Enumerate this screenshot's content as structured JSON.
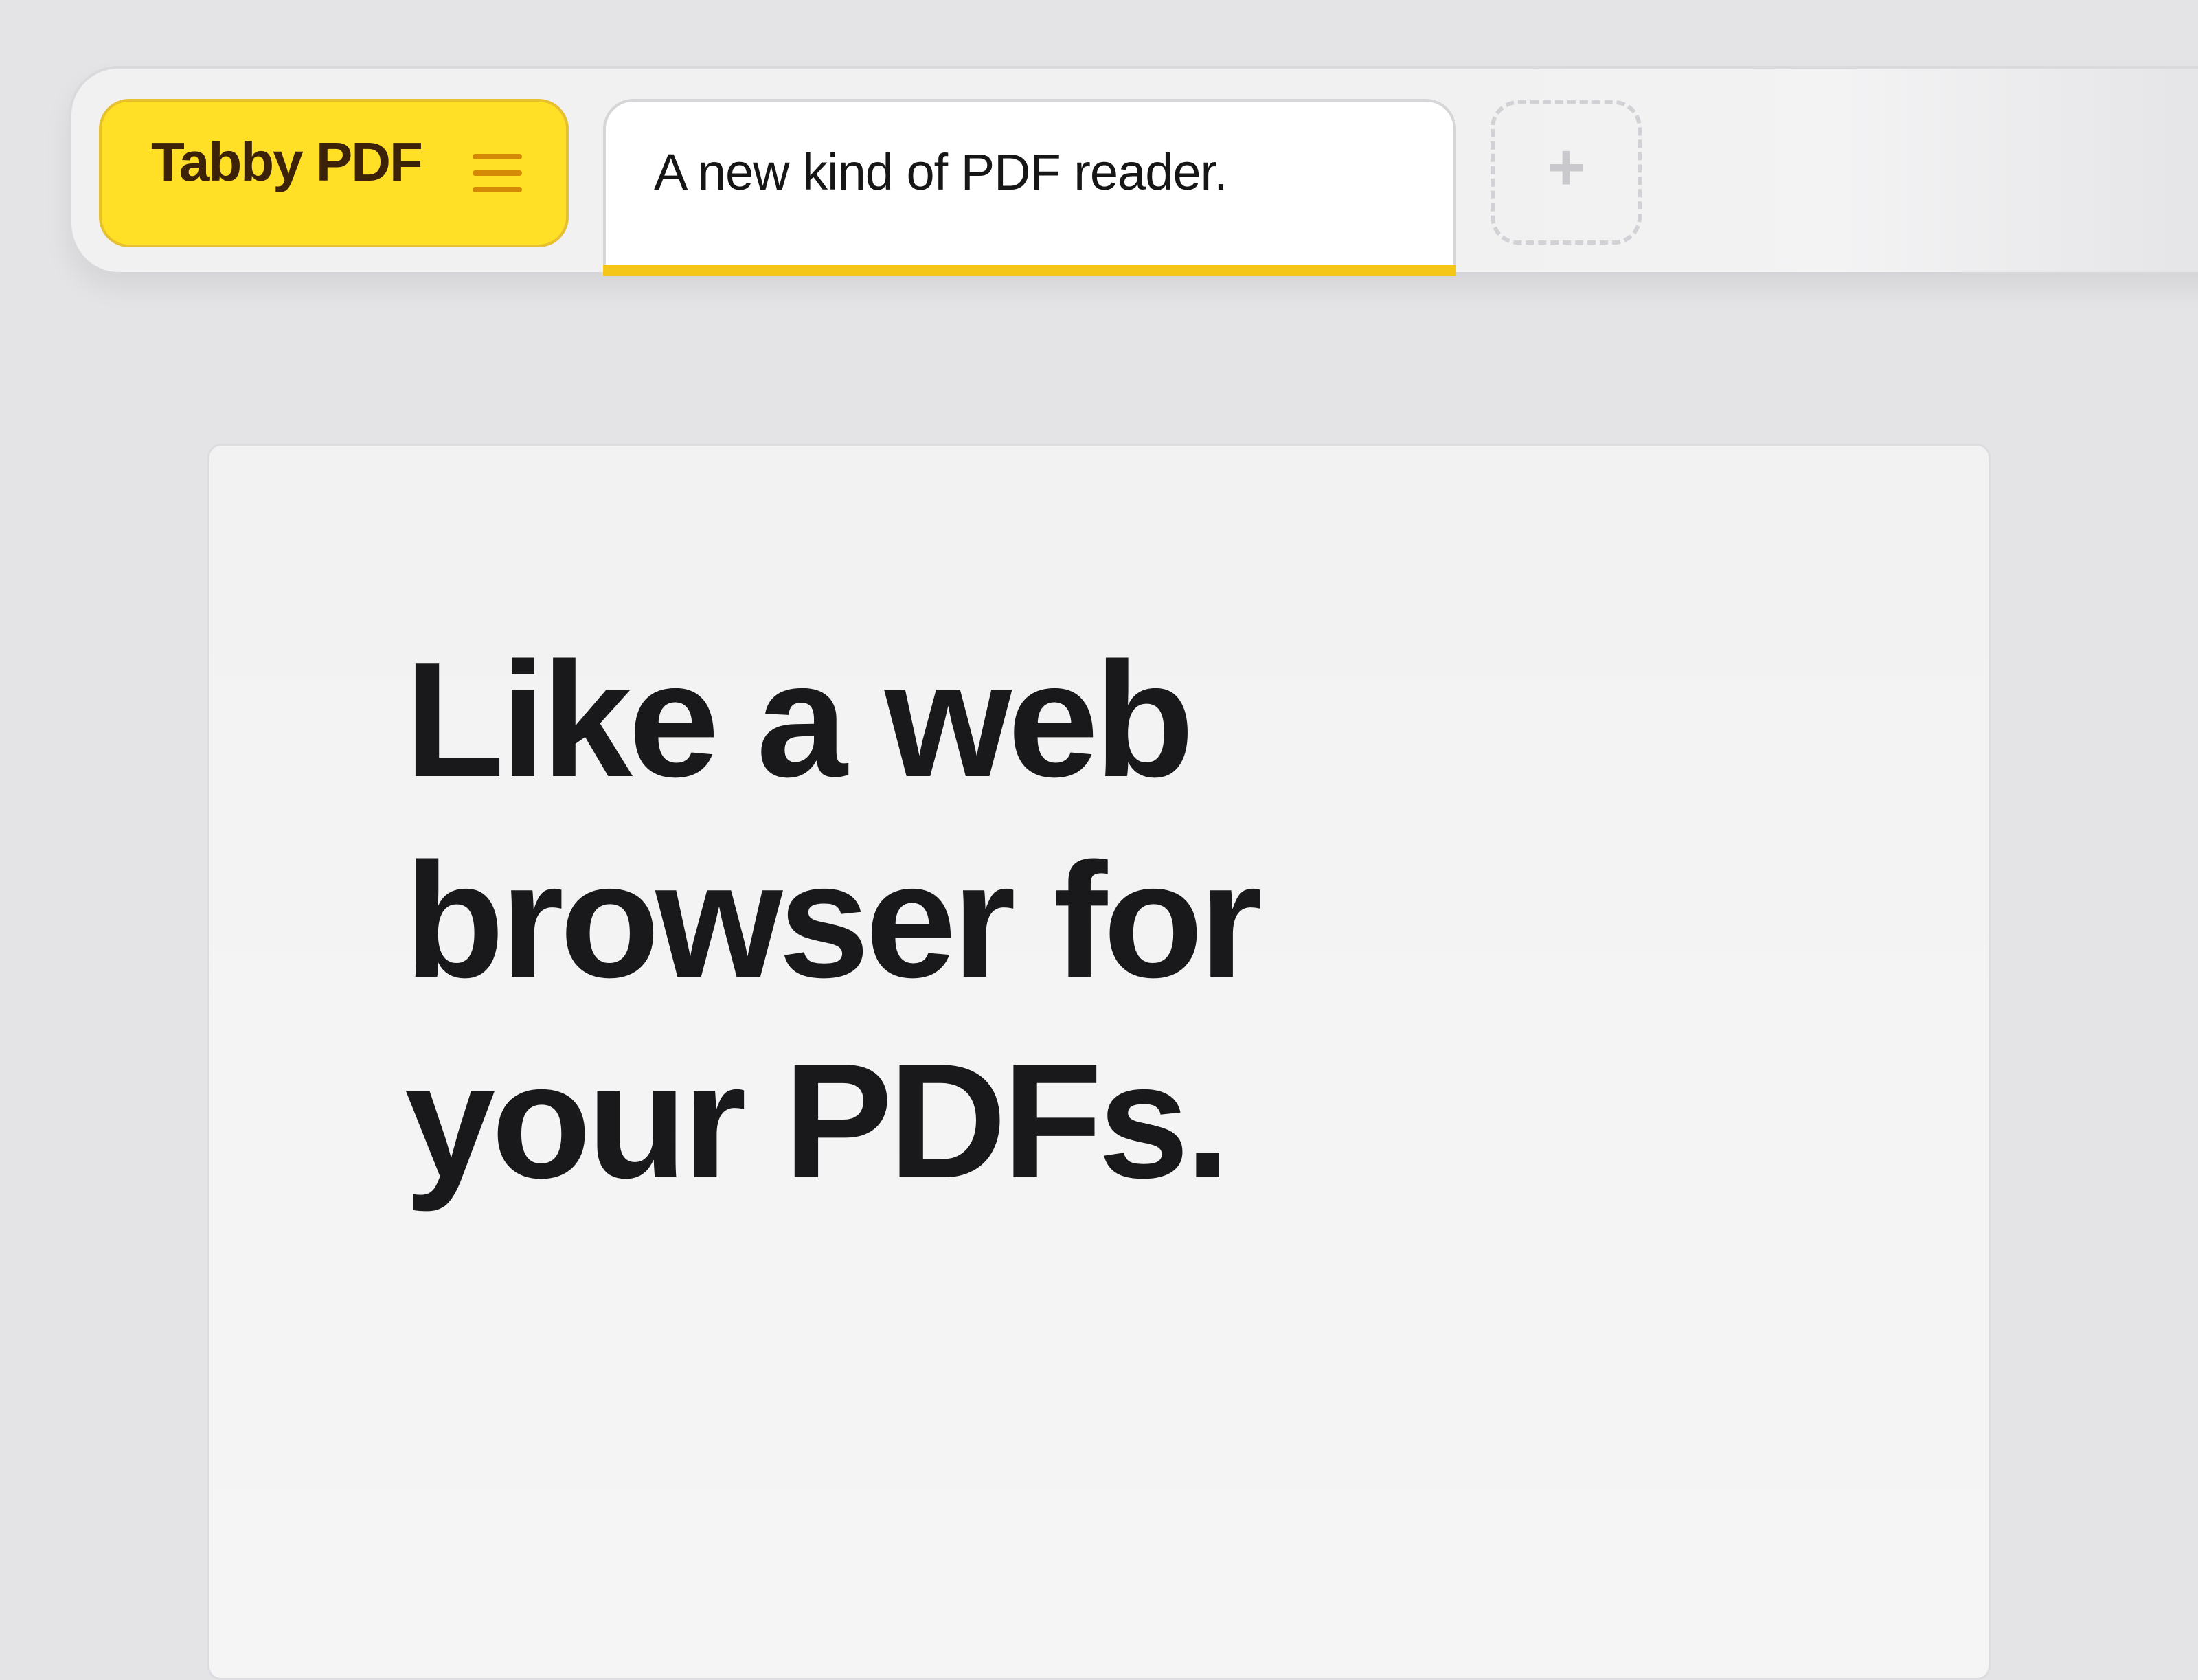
{
  "app": {
    "brand_name": "Tabby PDF",
    "brand_color": "#FFE026",
    "accent_color": "#F5C517"
  },
  "tabs": {
    "brand_tab": {
      "label": "Tabby PDF",
      "icon": "menu-icon"
    },
    "active_tab": {
      "label": "A new kind of PDF reader."
    },
    "new_tab": {
      "label": "+",
      "icon": "plus-icon"
    }
  },
  "main": {
    "headline": "Like a web browser for your PDFs."
  }
}
